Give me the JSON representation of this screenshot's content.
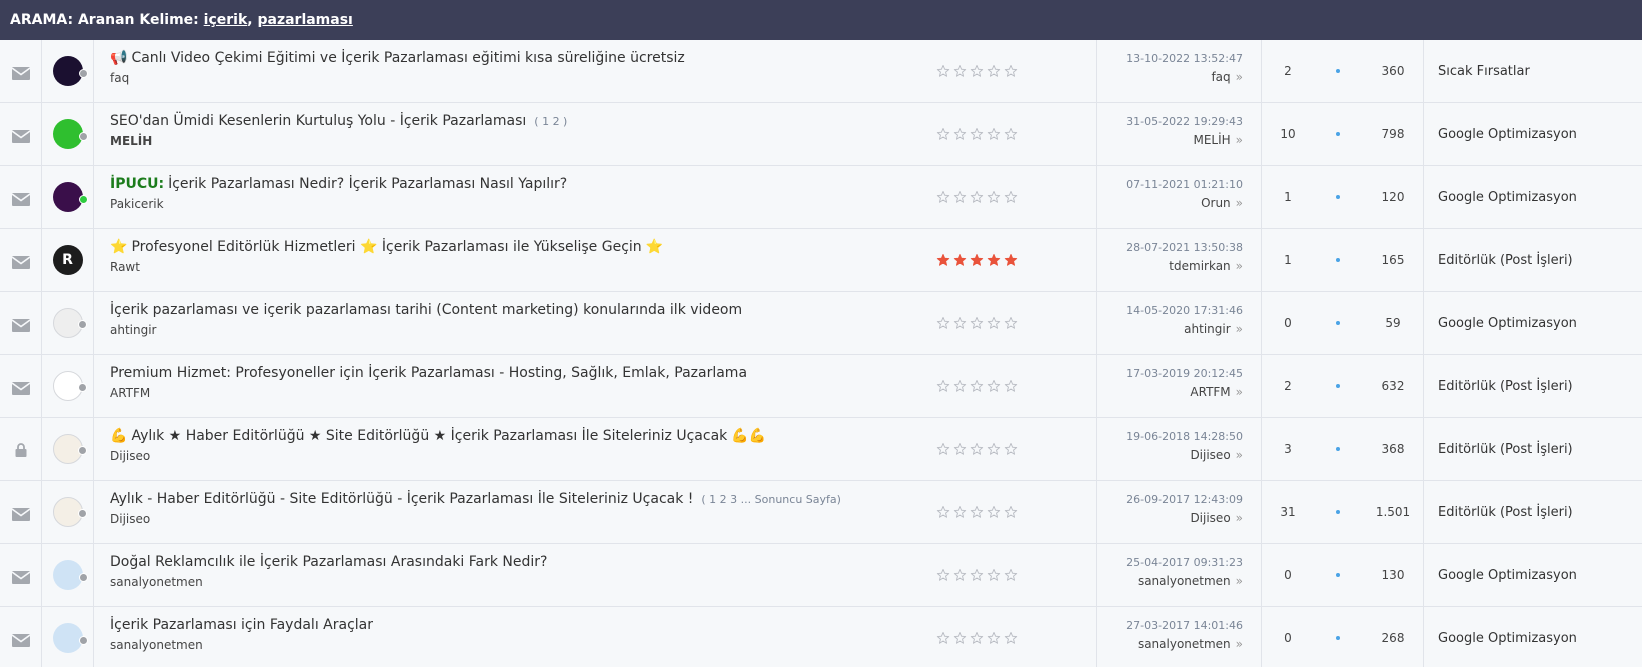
{
  "header": {
    "prefix": "ARAMA:",
    "label": "Aranan Kelime:",
    "term1": "içerik",
    "sep": ",",
    "term2": "pazarlaması"
  },
  "colors": {
    "header_bg": "#3c3f58",
    "star_filled": "#e9533b",
    "star_empty": "#b9bcc3",
    "online": "#2ecc40",
    "offline": "#a0a3a8",
    "stat_dot": "#4aa3e6",
    "prefix": "#1c7c1c"
  },
  "topics": [
    {
      "icon": "mail-icon",
      "avatar_bg": "#1b1030",
      "avatar_label": "",
      "status": "offline",
      "prefix": "",
      "emoji_before": "📢",
      "title": "Canlı Video Çekimi Eğitimi ve İçerik Pazarlaması eğitimi kısa süreliğine ücretsiz",
      "emoji_after": "",
      "pages": "",
      "author": "faq",
      "author_bold": false,
      "rating": 0,
      "date": "13-10-2022 13:52:47",
      "last_user": "faq",
      "replies": "2",
      "views": "360",
      "forum": "Sıcak Fırsatlar"
    },
    {
      "icon": "mail-icon",
      "avatar_bg": "#2fbf2f",
      "avatar_label": "",
      "status": "offline",
      "prefix": "",
      "emoji_before": "",
      "title": "SEO'dan Ümidi Kesenlerin Kurtuluş Yolu - İçerik Pazarlaması",
      "emoji_after": "",
      "pages": "( 1 2 )",
      "author": "MELİH",
      "author_bold": true,
      "rating": 0,
      "date": "31-05-2022 19:29:43",
      "last_user": "MELİH",
      "replies": "10",
      "views": "798",
      "forum": "Google Optimizasyon"
    },
    {
      "icon": "mail-icon",
      "avatar_bg": "#3a0f4a",
      "avatar_label": "",
      "status": "online",
      "prefix": "İPUCU:",
      "emoji_before": "",
      "title": "İçerik Pazarlaması Nedir? İçerik Pazarlaması Nasıl Yapılır?",
      "emoji_after": "",
      "pages": "",
      "author": "Pakicerik",
      "author_bold": false,
      "rating": 0,
      "date": "07-11-2021 01:21:10",
      "last_user": "Orun",
      "replies": "1",
      "views": "120",
      "forum": "Google Optimizasyon"
    },
    {
      "icon": "mail-icon",
      "avatar_bg": "#1d1d1d",
      "avatar_label": "R",
      "status": "none",
      "prefix": "",
      "emoji_before": "⭐",
      "title": "Profesyonel Editörlük Hizmetleri ⭐ İçerik Pazarlaması ile Yükselişe Geçin",
      "emoji_after": "⭐",
      "pages": "",
      "author": "Rawt",
      "author_bold": false,
      "rating": 5,
      "date": "28-07-2021 13:50:38",
      "last_user": "tdemirkan",
      "replies": "1",
      "views": "165",
      "forum": "Editörlük (Post İşleri)"
    },
    {
      "icon": "mail-icon",
      "avatar_bg": "#eeeeee",
      "avatar_label": "",
      "status": "offline",
      "prefix": "",
      "emoji_before": "",
      "title": "İçerik pazarlaması ve içerik pazarlaması tarihi (Content marketing) konularında ilk videom",
      "emoji_after": "",
      "pages": "",
      "author": "ahtingir",
      "author_bold": false,
      "rating": 0,
      "date": "14-05-2020 17:31:46",
      "last_user": "ahtingir",
      "replies": "0",
      "views": "59",
      "forum": "Google Optimizasyon"
    },
    {
      "icon": "mail-icon",
      "avatar_bg": "#ffffff",
      "avatar_label": "",
      "status": "offline",
      "prefix": "",
      "emoji_before": "",
      "title": "Premium Hizmet: Profesyoneller için İçerik Pazarlaması - Hosting, Sağlık, Emlak, Pazarlama",
      "emoji_after": "",
      "pages": "",
      "author": "ARTFM",
      "author_bold": false,
      "rating": 0,
      "date": "17-03-2019 20:12:45",
      "last_user": "ARTFM",
      "replies": "2",
      "views": "632",
      "forum": "Editörlük (Post İşleri)"
    },
    {
      "icon": "lock-icon",
      "avatar_bg": "#f4efe6",
      "avatar_label": "",
      "status": "offline",
      "prefix": "",
      "emoji_before": "💪",
      "title": "Aylık ★ Haber Editörlüğü ★ Site Editörlüğü ★ İçerik Pazarlaması İle Siteleriniz Uçacak",
      "emoji_after": "💪💪",
      "pages": "",
      "author": "Dijiseo",
      "author_bold": false,
      "rating": 0,
      "date": "19-06-2018 14:28:50",
      "last_user": "Dijiseo",
      "replies": "3",
      "views": "368",
      "forum": "Editörlük (Post İşleri)"
    },
    {
      "icon": "mail-icon",
      "avatar_bg": "#f4efe6",
      "avatar_label": "",
      "status": "offline",
      "prefix": "",
      "emoji_before": "",
      "title": "Aylık - Haber Editörlüğü - Site Editörlüğü - İçerik Pazarlaması İle Siteleriniz Uçacak !",
      "emoji_after": "",
      "pages": "( 1 2 3 ... Sonuncu Sayfa)",
      "author": "Dijiseo",
      "author_bold": false,
      "rating": 0,
      "date": "26-09-2017 12:43:09",
      "last_user": "Dijiseo",
      "replies": "31",
      "views": "1.501",
      "forum": "Editörlük (Post İşleri)"
    },
    {
      "icon": "mail-icon",
      "avatar_bg": "#cfe3f5",
      "avatar_label": "",
      "status": "offline",
      "prefix": "",
      "emoji_before": "",
      "title": "Doğal Reklamcılık ile İçerik Pazarlaması Arasındaki Fark Nedir?",
      "emoji_after": "",
      "pages": "",
      "author": "sanalyonetmen",
      "author_bold": false,
      "rating": 0,
      "date": "25-04-2017 09:31:23",
      "last_user": "sanalyonetmen",
      "replies": "0",
      "views": "130",
      "forum": "Google Optimizasyon"
    },
    {
      "icon": "mail-icon",
      "avatar_bg": "#cfe3f5",
      "avatar_label": "",
      "status": "offline",
      "prefix": "",
      "emoji_before": "",
      "title": "İçerik Pazarlaması için Faydalı Araçlar",
      "emoji_after": "",
      "pages": "",
      "author": "sanalyonetmen",
      "author_bold": false,
      "rating": 0,
      "date": "27-03-2017 14:01:46",
      "last_user": "sanalyonetmen",
      "replies": "0",
      "views": "268",
      "forum": "Google Optimizasyon"
    }
  ]
}
